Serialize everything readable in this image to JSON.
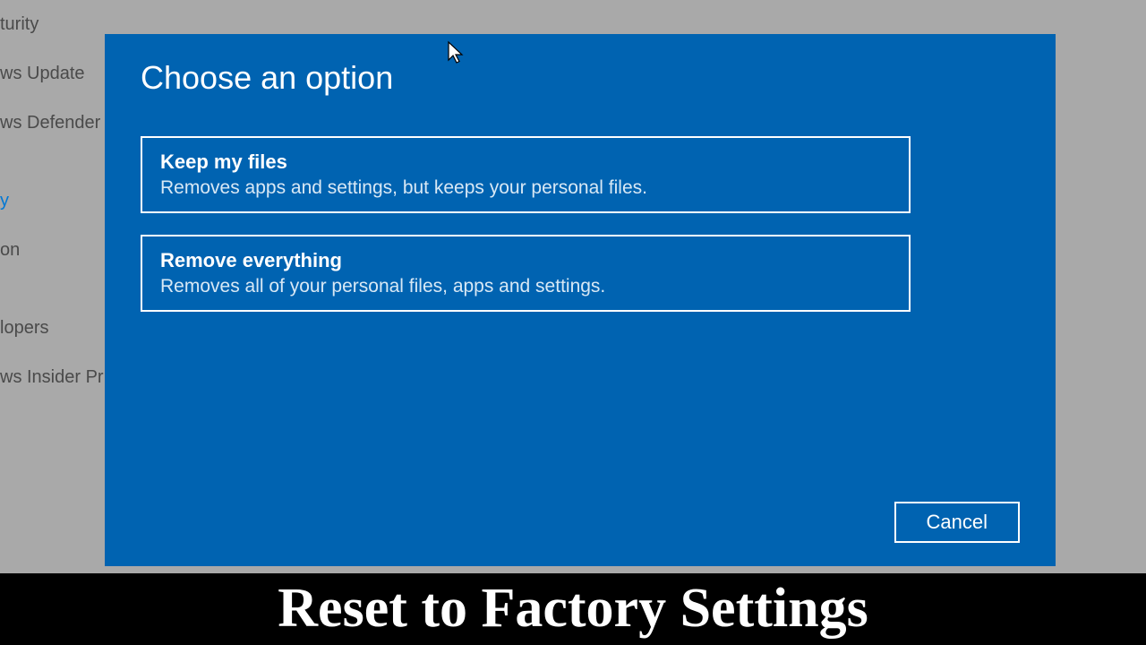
{
  "sidebar": {
    "items": [
      {
        "label": "turity"
      },
      {
        "label": "ws Update"
      },
      {
        "label": "ws Defender"
      },
      {
        "label": ""
      },
      {
        "label": "y"
      },
      {
        "label": "on"
      },
      {
        "label": ""
      },
      {
        "label": "lopers"
      },
      {
        "label": "ws Insider Pr"
      }
    ]
  },
  "dialog": {
    "title": "Choose an option",
    "options": [
      {
        "title": "Keep my files",
        "desc": "Removes apps and settings, but keeps your personal files."
      },
      {
        "title": "Remove everything",
        "desc": "Removes all of your personal files, apps and settings."
      }
    ],
    "cancel_label": "Cancel"
  },
  "caption": "Reset to Factory Settings"
}
